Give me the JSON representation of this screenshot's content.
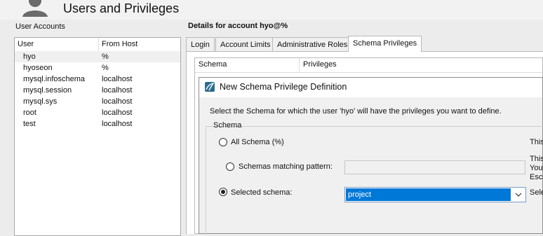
{
  "page": {
    "title": "Users and Privileges"
  },
  "accounts": {
    "label": "User Accounts",
    "columns": [
      "User",
      "From Host"
    ],
    "rows": [
      {
        "user": "hyo",
        "host": "%"
      },
      {
        "user": "hyoseon",
        "host": "%"
      },
      {
        "user": "mysql.infoschema",
        "host": "localhost"
      },
      {
        "user": "mysql.session",
        "host": "localhost"
      },
      {
        "user": "mysql.sys",
        "host": "localhost"
      },
      {
        "user": "root",
        "host": "localhost"
      },
      {
        "user": "test",
        "host": "localhost"
      }
    ],
    "selected_index": 0
  },
  "details": {
    "title": "Details for account hyo@%",
    "tabs": [
      "Login",
      "Account Limits",
      "Administrative Roles",
      "Schema Privileges"
    ],
    "active_tab": 3
  },
  "privileges_table": {
    "columns": [
      "Schema",
      "Privileges"
    ]
  },
  "dialog": {
    "title": "New Schema Privilege Definition",
    "description": "Select the Schema for which the user 'hyo' will have the privileges you want to define.",
    "group_label": "Schema",
    "options": [
      {
        "label": "All Schema (%)",
        "selected": false,
        "side_text": [
          "This"
        ]
      },
      {
        "label": "Schemas matching pattern:",
        "selected": false,
        "side_text": [
          "This",
          "You",
          "Esca"
        ]
      },
      {
        "label": "Selected schema:",
        "selected": true,
        "side_text": [
          "Sele"
        ]
      }
    ],
    "pattern_value": "",
    "selected_schema": "project"
  },
  "colors": {
    "selection_blue": "#0078d7",
    "tab_active_bg": "#ffffff",
    "window_bg": "#ececec"
  },
  "icons": [
    "user-silhouette-icon",
    "workbench-dolphin-icon",
    "chevron-down-icon"
  ]
}
